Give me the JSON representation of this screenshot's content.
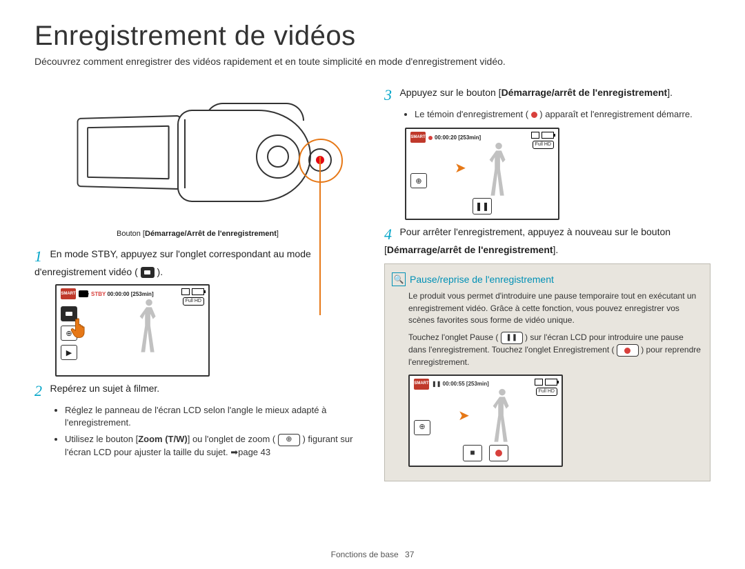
{
  "title": "Enregistrement de vidéos",
  "intro": "Découvrez comment enregistrer des vidéos rapidement et en toute simplicité en mode d'enregistrement vidéo.",
  "camcorder_caption_prefix": "Bouton [",
  "camcorder_caption_bold": "Démarrage/Arrêt de l'enregistrement",
  "camcorder_caption_suffix": "]",
  "step1": {
    "num": "1",
    "text_a": "En mode STBY, appuyez sur l'onglet correspondant au mode d'enregistrement vidéo ( ",
    "text_b": " )."
  },
  "lcd1": {
    "smart": "SMART",
    "tc_label": "STBY",
    "tc_time": "00:00:00",
    "tc_rem": "[253min]",
    "res": "Full HD",
    "zoom": "⊕",
    "play": "▶",
    "mode": "🎥"
  },
  "step2": {
    "num": "2",
    "text": "Repérez un sujet à filmer.",
    "b1": "Réglez le panneau de l'écran LCD selon l'angle le mieux adapté à l'enregistrement.",
    "b2_a": "Utilisez le bouton [",
    "b2_bold": "Zoom (T/W)",
    "b2_b": "] ou l'onglet de zoom ( ",
    "b2_c": " ) figurant sur l'écran LCD pour ajuster la taille du sujet. ",
    "b2_ref": "➡page 43"
  },
  "step3": {
    "num": "3",
    "text_a": "Appuyez sur le bouton [",
    "text_bold": "Démarrage/arrêt de l'enregistrement",
    "text_b": "].",
    "b1_a": "Le témoin d'enregistrement ( ",
    "b1_b": " ) apparaît et l'enregistrement démarre."
  },
  "lcd2": {
    "smart": "SMART",
    "tc_time": "00:00:20",
    "tc_rem": "[253min]",
    "res": "Full HD",
    "zoom": "⊕",
    "pause": "❚❚"
  },
  "step4": {
    "num": "4",
    "text_a": "Pour arrêter l'enregistrement, appuyez à nouveau sur le bouton [",
    "text_bold": "Démarrage/arrêt de l'enregistrement",
    "text_b": "]."
  },
  "note": {
    "title": "Pause/reprise de l'enregistrement",
    "p1": "Le produit vous permet d'introduire une pause temporaire tout en exécutant un enregistrement vidéo. Grâce à cette fonction, vous pouvez enregistrer vos scènes favorites sous forme de vidéo unique.",
    "p2_a": "Touchez l'onglet Pause ( ",
    "p2_b": " ) sur l'écran LCD pour introduire une pause dans l'enregistrement. Touchez l'onglet Enregistrement ( ",
    "p2_c": " ) pour reprendre l'enregistrement.",
    "lcd": {
      "smart": "SMART",
      "tc_time": "00:00:55",
      "tc_rem": "[253min]",
      "res": "Full HD",
      "zoom": "⊕"
    }
  },
  "footer": {
    "section": "Fonctions de base",
    "page": "37"
  }
}
